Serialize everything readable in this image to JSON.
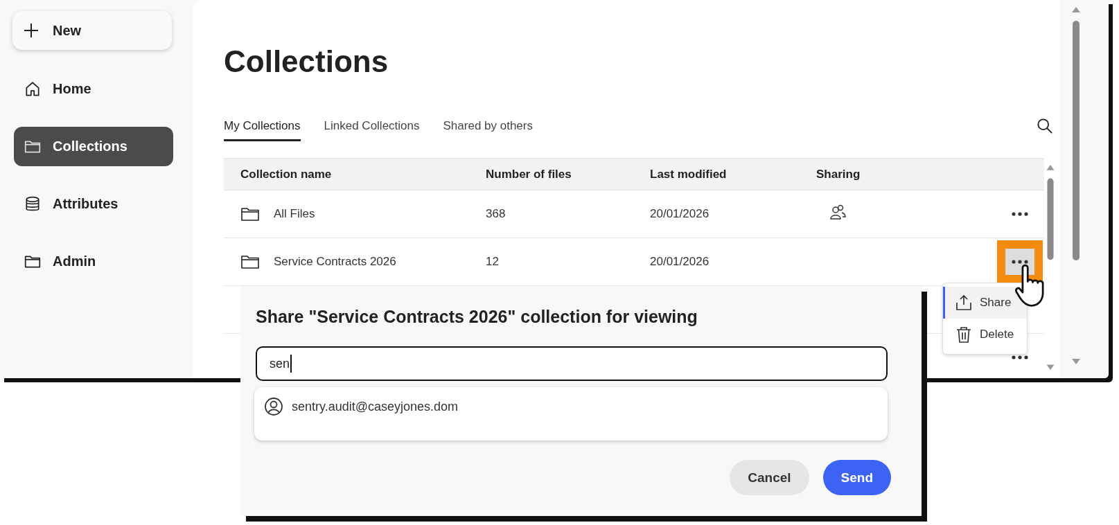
{
  "sidebar": {
    "new_button": "New",
    "items": [
      {
        "label": "Home",
        "kind": "home",
        "selected": false
      },
      {
        "label": "Collections",
        "kind": "folder",
        "selected": true
      },
      {
        "label": "Attributes",
        "kind": "database",
        "selected": false
      },
      {
        "label": "Admin",
        "kind": "folder",
        "selected": false
      }
    ]
  },
  "page": {
    "title": "Collections"
  },
  "tabs": [
    {
      "label": "My Collections",
      "selected": true
    },
    {
      "label": "Linked Collections",
      "selected": false
    },
    {
      "label": "Shared by others",
      "selected": false
    }
  ],
  "table": {
    "columns": [
      "Collection name",
      "Number of files",
      "Last modified",
      "Sharing"
    ],
    "rows": [
      {
        "name": "All Files",
        "files": "368",
        "modified": "20/01/2026",
        "shared": true,
        "actions_visible": true
      },
      {
        "name": "Service Contracts 2026",
        "files": "12",
        "modified": "20/01/2026",
        "shared": false,
        "actions_visible": true,
        "highlighted": true
      },
      {
        "actions_visible": false
      },
      {
        "actions_visible": true
      }
    ]
  },
  "row_menu": {
    "items": [
      {
        "label": "Share",
        "kind": "share",
        "selected": true
      },
      {
        "label": "Delete",
        "kind": "delete",
        "selected": false
      }
    ]
  },
  "dialog": {
    "title": "Share \"Service Contracts 2026\" collection for viewing",
    "input": {
      "value": "sen"
    },
    "suggestions": [
      "sentry.audit@caseyjones.dom"
    ],
    "buttons": [
      {
        "label": "Cancel",
        "kind": "secondary"
      },
      {
        "label": "Send",
        "kind": "primary"
      }
    ]
  }
}
